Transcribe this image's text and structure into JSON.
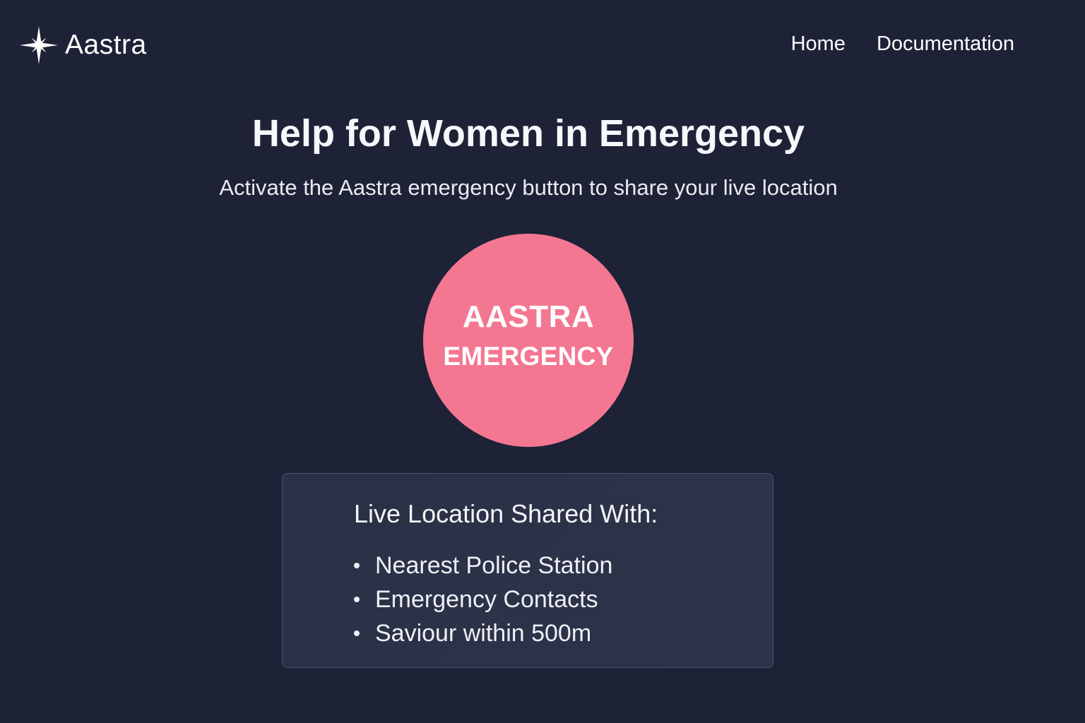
{
  "header": {
    "brand": {
      "name": "Aastra",
      "icon": "four-point-star-icon"
    },
    "nav": [
      {
        "label": "Home"
      },
      {
        "label": "Documentation"
      }
    ]
  },
  "hero": {
    "title": "Help for Women in Emergency",
    "subtitle": "Activate the Aastra emergency button to share your live location"
  },
  "emergency_button": {
    "line1": "AASTRA",
    "line2": "EMERGENCY",
    "color": "#f47792"
  },
  "info_card": {
    "title": "Live Location Shared With:",
    "items": [
      {
        "label": "Nearest Police Station"
      },
      {
        "label": "Emergency Contacts"
      },
      {
        "label": "Saviour within 500m"
      }
    ]
  },
  "colors": {
    "background": "#1e2236",
    "card_background": "#2b3147",
    "card_border": "#4b5168",
    "text": "#f3f4f8"
  }
}
